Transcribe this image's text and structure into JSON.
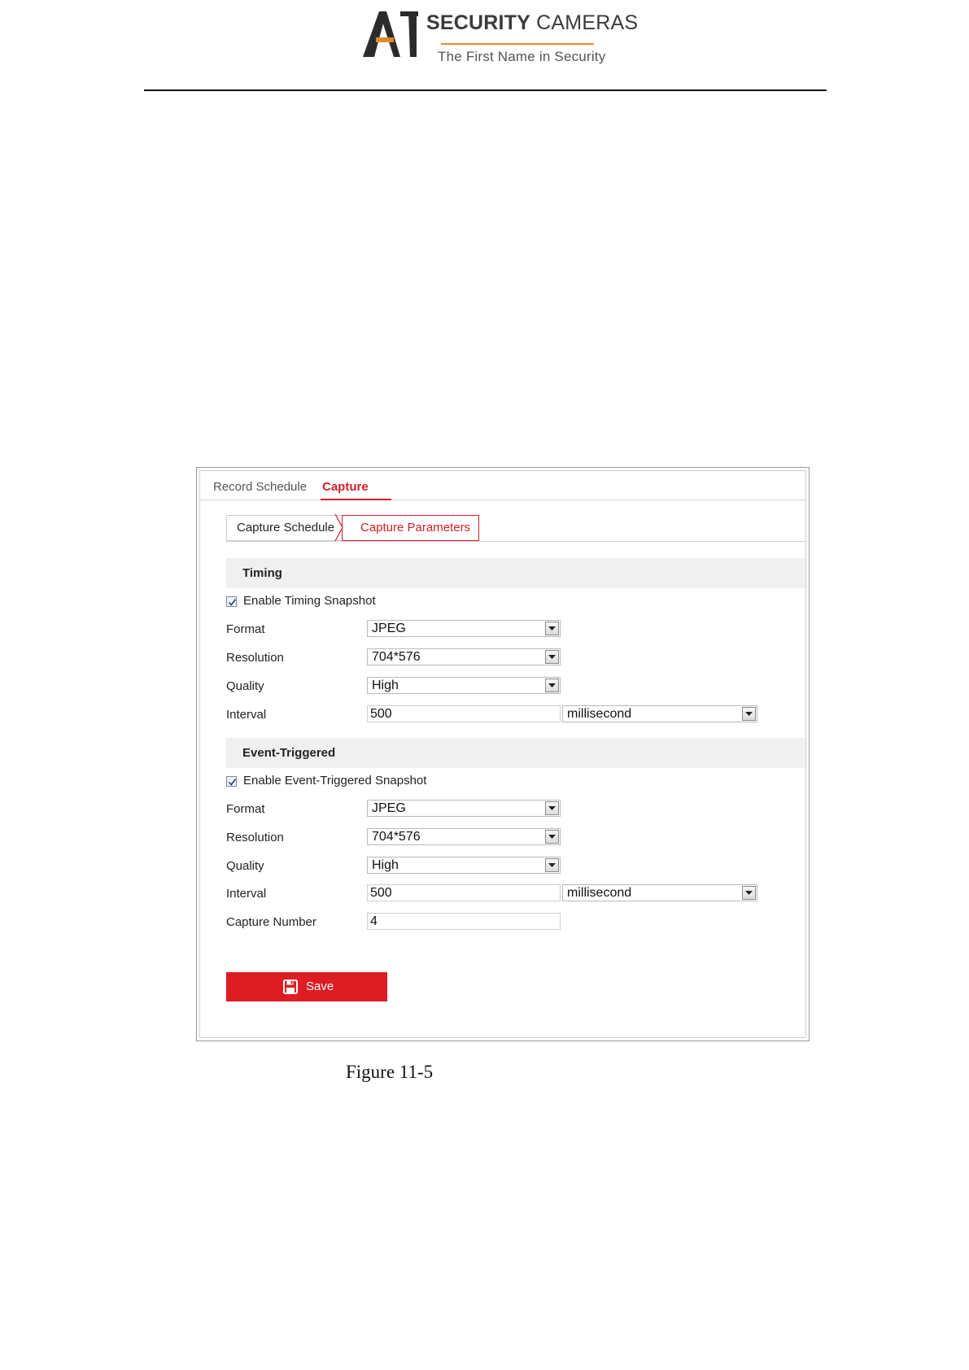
{
  "header": {
    "logo_text": "AI",
    "brand_bold": "SECURITY",
    "brand_light": "CAMERAS",
    "tagline": "The First Name in Security",
    "colors": {
      "accent": "#e08b2a",
      "ink": "#2b2b2b"
    }
  },
  "tabs": [
    {
      "label": "Record Schedule",
      "active": false
    },
    {
      "label": "Capture",
      "active": true
    }
  ],
  "subtabs": [
    {
      "label": "Capture Schedule",
      "active": false
    },
    {
      "label": "Capture Parameters",
      "active": true
    }
  ],
  "timing": {
    "title": "Timing",
    "enable_label": "Enable Timing Snapshot",
    "enabled": true,
    "format": {
      "label": "Format",
      "value": "JPEG"
    },
    "resolution": {
      "label": "Resolution",
      "value": "704*576"
    },
    "quality": {
      "label": "Quality",
      "value": "High"
    },
    "interval": {
      "label": "Interval",
      "value": "500",
      "unit": "millisecond"
    }
  },
  "event": {
    "title": "Event-Triggered",
    "enable_label": "Enable Event-Triggered Snapshot",
    "enabled": true,
    "format": {
      "label": "Format",
      "value": "JPEG"
    },
    "resolution": {
      "label": "Resolution",
      "value": "704*576"
    },
    "quality": {
      "label": "Quality",
      "value": "High"
    },
    "interval": {
      "label": "Interval",
      "value": "500",
      "unit": "millisecond"
    },
    "capture_number": {
      "label": "Capture Number",
      "value": "4"
    }
  },
  "save": {
    "label": "Save",
    "icon": "save-icon",
    "color": "#dd1c24"
  },
  "caption": "Figure 11-5",
  "colors": {
    "active_tab": "#d11f27",
    "section_bg": "#f0f0f0"
  }
}
